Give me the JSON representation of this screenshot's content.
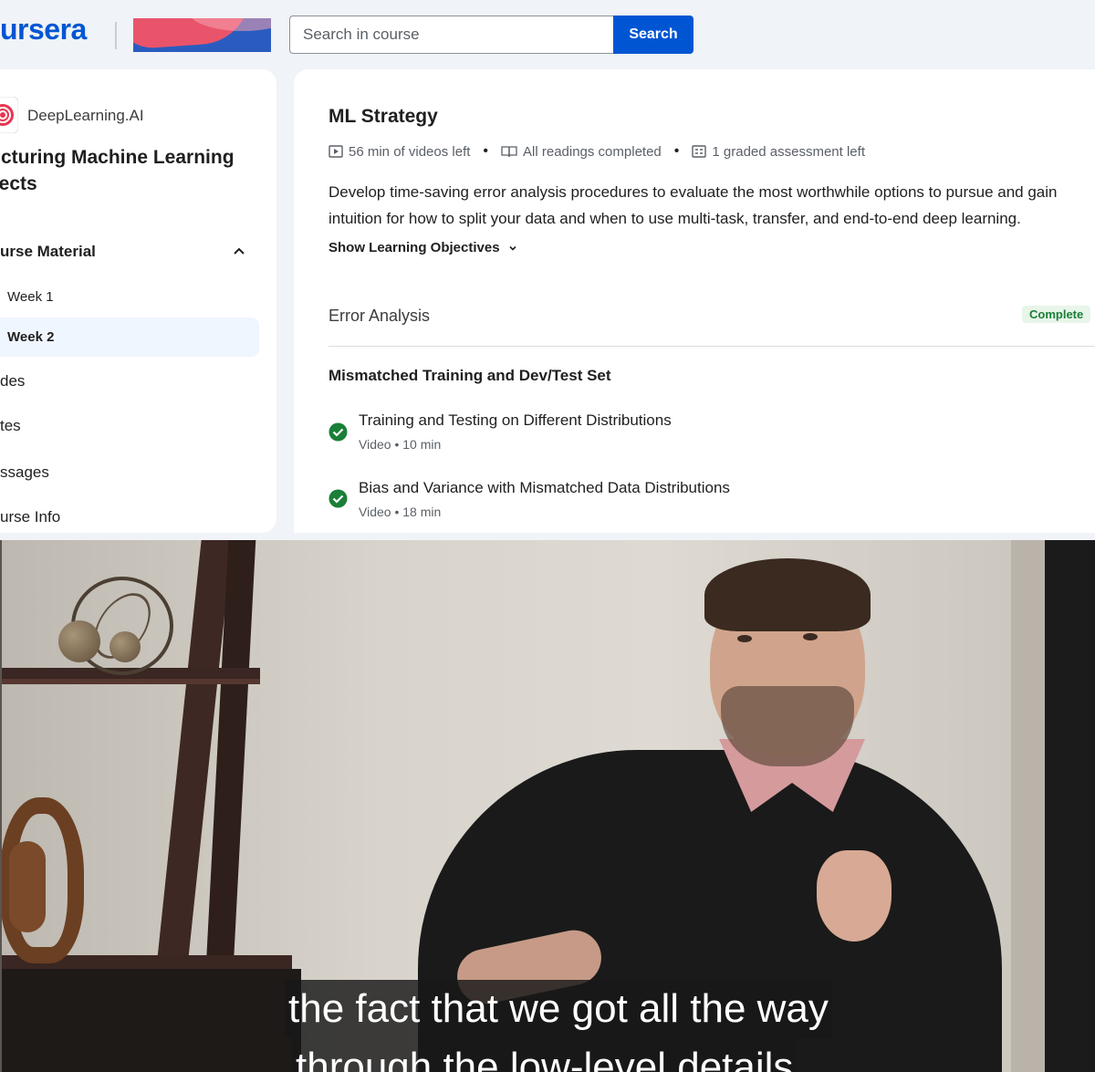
{
  "header": {
    "logo_text": "ursera",
    "search": {
      "placeholder": "Search in course",
      "button_label": "Search"
    }
  },
  "sidebar": {
    "org_name": "DeepLearning.AI",
    "course_title_line1": "ructuring Machine Learning",
    "course_title_line2": "ojects",
    "section_label": "urse Material",
    "weeks": [
      {
        "label": "Week 1",
        "active": false
      },
      {
        "label": "Week 2",
        "active": true
      }
    ],
    "links": [
      "des",
      "tes",
      "ssages",
      "urse Info"
    ]
  },
  "main": {
    "module_title": "ML Strategy",
    "meta": {
      "videos_left": "56 min of videos left",
      "readings": "All readings completed",
      "assessments": "1 graded assessment left"
    },
    "description": "Develop time-saving error analysis procedures to evaluate the most worthwhile options to pursue and gain intuition for how to split your data and when to use multi-task, transfer, and end-to-end deep learning.",
    "objectives_label": "Show Learning Objectives",
    "lesson": {
      "title": "Error Analysis",
      "status": "Complete"
    },
    "subsection_title": "Mismatched Training and Dev/Test Set",
    "items": [
      {
        "title": "Training and Testing on Different Distributions",
        "meta": "Video • 10 min"
      },
      {
        "title": "Bias and Variance with Mismatched Data Distributions",
        "meta": "Video • 18 min"
      }
    ]
  },
  "video": {
    "caption_line1": "the fact that we got all the way",
    "caption_line2": "through the low-level details"
  },
  "colors": {
    "brand": "#0056d2",
    "success": "#1a7f37",
    "active_bg": "#f0f6ff"
  }
}
